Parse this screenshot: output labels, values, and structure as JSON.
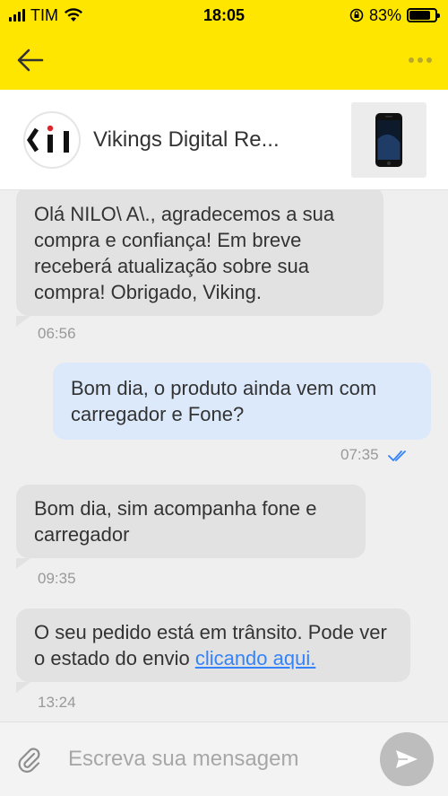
{
  "status_bar": {
    "carrier": "TIM",
    "time": "18:05",
    "battery_percent": "83%",
    "battery_level": 0.83
  },
  "app_bar": {
    "back_icon": "arrow-left-icon",
    "more_icon": "more-dots-icon",
    "bar_color": "#ffe600"
  },
  "seller": {
    "name": "Vikings Digital Re...",
    "logo_text": "‹ I I",
    "product_thumb_icon": "smartphone-icon"
  },
  "messages": [
    {
      "direction": "in",
      "text": "Olá NILO\\ A\\., agradecemos a sua compra e confiança! Em breve receberá atualização sobre sua compra! Obrigado, Viking.",
      "time": "06:56"
    },
    {
      "direction": "out",
      "text": "Bom dia, o produto ainda vem com carregador e Fone?",
      "time": "07:35",
      "read": true
    },
    {
      "direction": "in",
      "text": "Bom dia, sim acompanha fone e carregador",
      "time": "09:35"
    },
    {
      "direction": "in",
      "text_before_link": "O seu pedido está em trânsito. Pode ver o estado do envio ",
      "link_text": "clicando aqui.",
      "time": "13:24"
    }
  ],
  "composer": {
    "placeholder": "Escreva sua mensagem",
    "attach_icon": "paperclip-icon",
    "send_icon": "send-icon"
  },
  "colors": {
    "brand_yellow": "#ffe600",
    "link_blue": "#3483fa",
    "incoming_bubble": "#e2e2e2",
    "outgoing_bubble": "#dbe9fb"
  }
}
